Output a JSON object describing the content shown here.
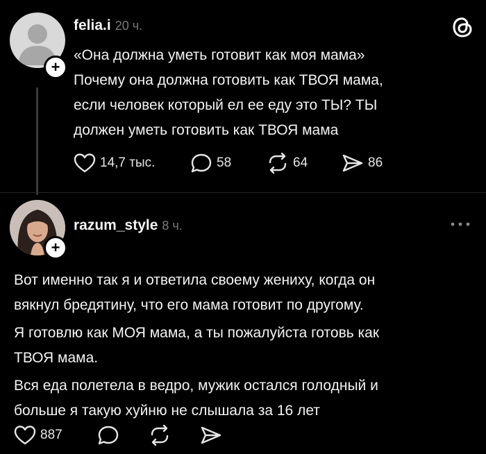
{
  "post1": {
    "username": "felia.i",
    "time": "20 ч.",
    "lines": [
      "«Она должна уметь готовит как моя мама»",
      "Почему она должна готовить как ТВОЯ мама,",
      "если человек который ел ее еду это ТЫ? ТЫ",
      "должен уметь готовить как ТВОЯ мама"
    ],
    "likes": "14,7 тыс.",
    "replies": "58",
    "reposts": "64",
    "shares": "86"
  },
  "post2": {
    "username": "razum_style",
    "time": "8 ч.",
    "lines": [
      "Вот именно так я и ответила своему жениху, когда он",
      "вякнул бредятину, что его мама готовит по другому.",
      "Я готовлю как МОЯ мама, а ты пожалуйста готовь как",
      "ТВОЯ мама.",
      "Вся еда полетела в ведро, мужик остался голодный и",
      "больше я такую хуйню не слышала за 16 лет"
    ],
    "likes": "887"
  },
  "icons": {
    "threads_logo": "threads-logo-icon",
    "more": "more-icon",
    "like": "heart-icon",
    "reply": "comment-icon",
    "repost": "repost-icon",
    "share": "share-icon",
    "follow": "plus-icon"
  }
}
